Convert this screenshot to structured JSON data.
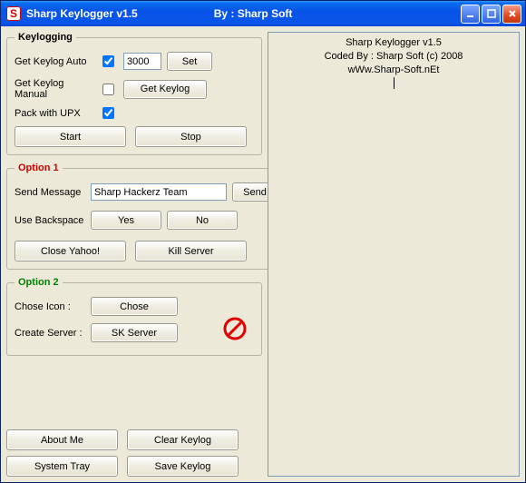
{
  "title": {
    "left": "Sharp Keylogger v1.5",
    "right": "By : Sharp Soft"
  },
  "keylogging": {
    "legend": "Keylogging",
    "get_auto_label": "Get Keylog Auto",
    "get_auto_checked": true,
    "interval_value": "3000",
    "set_label": "Set",
    "get_manual_label": "Get Keylog Manual",
    "get_manual_checked": false,
    "get_keylog_label": "Get Keylog",
    "pack_upx_label": "Pack with UPX",
    "pack_upx_checked": true,
    "start_label": "Start",
    "stop_label": "Stop"
  },
  "option1": {
    "legend": "Option 1",
    "send_message_label": "Send Message",
    "send_message_value": "Sharp Hackerz Team",
    "send_label": "Send",
    "use_backspace_label": "Use Backspace",
    "yes_label": "Yes",
    "no_label": "No",
    "close_yahoo_label": "Close Yahoo!",
    "kill_server_label": "Kill Server"
  },
  "option2": {
    "legend": "Option 2",
    "chose_icon_label": "Chose Icon :",
    "chose_label": "Chose",
    "create_server_label": "Create Server :",
    "sk_server_label": "SK Server"
  },
  "bottom": {
    "about_me": "About Me",
    "clear_keylog": "Clear Keylog",
    "system_tray": "System Tray",
    "save_keylog": "Save Keylog"
  },
  "log": {
    "line1": "Sharp Keylogger v1.5",
    "line2": "Coded By : Sharp Soft  (c) 2008",
    "line3": "wWw.Sharp-Soft.nEt"
  }
}
